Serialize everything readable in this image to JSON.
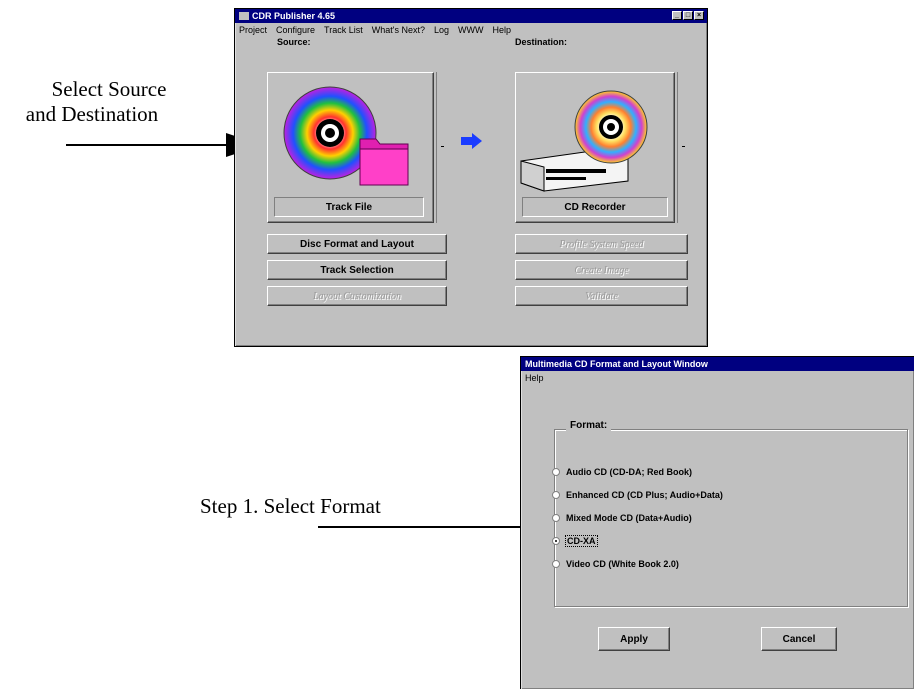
{
  "annotations": {
    "source_dest": [
      "Select Source",
      "and Destination"
    ],
    "step1": "Step 1. Select Format"
  },
  "main_window": {
    "title": "CDR Publisher 4.65",
    "menu": [
      "Project",
      "Configure",
      "Track List",
      "What's Next?",
      "Log",
      "WWW",
      "Help"
    ],
    "source_label": "Source:",
    "destination_label": "Destination:",
    "source_caption": "Track File",
    "destination_caption": "CD Recorder",
    "left_buttons": [
      {
        "label": "Disc Format and Layout",
        "enabled": true
      },
      {
        "label": "Track Selection",
        "enabled": true
      },
      {
        "label": "Layout Customization",
        "enabled": false
      }
    ],
    "right_buttons": [
      {
        "label": "Profile System Speed",
        "enabled": false
      },
      {
        "label": "Create Image",
        "enabled": false
      },
      {
        "label": "Validate",
        "enabled": false
      }
    ],
    "colors": {
      "arrow": "#1a3cff",
      "titlebar": "#000080",
      "folder": "#e020b0"
    }
  },
  "format_window": {
    "title": "Multimedia CD Format and Layout Window",
    "menu": [
      "Help"
    ],
    "group_label": "Format:",
    "options": [
      {
        "label": "Audio CD (CD-DA; Red Book)",
        "selected": false
      },
      {
        "label": "Enhanced CD (CD Plus; Audio+Data)",
        "selected": false
      },
      {
        "label": "Mixed Mode CD (Data+Audio)",
        "selected": false
      },
      {
        "label": "CD-XA",
        "selected": true
      },
      {
        "label": "Video CD (White Book 2.0)",
        "selected": false
      }
    ],
    "apply_label": "Apply",
    "cancel_label": "Cancel"
  }
}
